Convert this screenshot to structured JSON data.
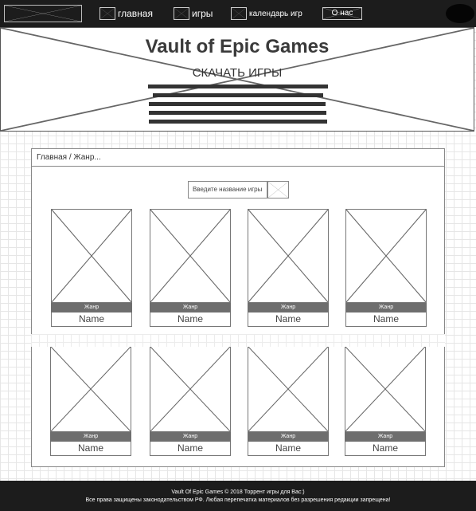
{
  "nav": {
    "items": [
      {
        "label": "главная",
        "icon": "image-placeholder-icon"
      },
      {
        "label": "игры",
        "icon": "image-placeholder-icon"
      },
      {
        "label": "календарь игр",
        "icon": "image-placeholder-icon"
      }
    ],
    "about_label": "О нас"
  },
  "hero": {
    "title": "Vault of Epic Games",
    "download_label": "СКАЧАТЬ ИГРЫ"
  },
  "content": {
    "breadcrumb": "Главная / Жанр...",
    "search": {
      "placeholder": "Введите название игры"
    }
  },
  "cards": [
    {
      "genre": "Жанр",
      "name": "Name"
    },
    {
      "genre": "Жанр",
      "name": "Name"
    },
    {
      "genre": "Жанр",
      "name": "Name"
    },
    {
      "genre": "Жанр",
      "name": "Name"
    },
    {
      "genre": "Жанр",
      "name": "Name"
    },
    {
      "genre": "Жанр",
      "name": "Name"
    },
    {
      "genre": "Жанр",
      "name": "Name"
    },
    {
      "genre": "Жанр",
      "name": "Name"
    }
  ],
  "footer": {
    "line1": "Vault Of Epic Games © 2018 Торрент игры для Вас:)",
    "line2": "Все права защищены законодательством РФ. Любая перепечатка материалов без разрешения редакции запрещена!"
  },
  "colors": {
    "bar_background": "#1c1c1c",
    "genre_band": "#6e6e6e",
    "wire_line": "#666666"
  }
}
